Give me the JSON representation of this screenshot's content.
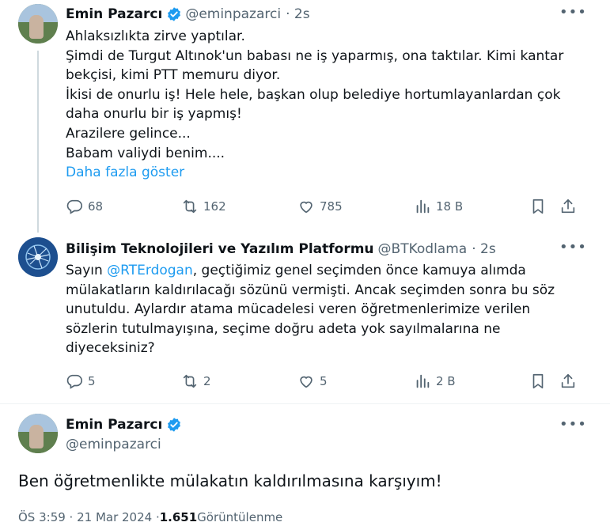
{
  "tweet1": {
    "author": "Emin Pazarcı",
    "handle": "@eminpazarci",
    "time": "· 2s",
    "lines": [
      "Ahlaksızlıkta zirve yaptılar.",
      "Şimdi de Turgut Altınok'un babası ne iş yaparmış, ona taktılar. Kimi kantar",
      "bekçisi, kimi PTT memuru diyor.",
      "İkisi de onurlu iş! Hele hele, başkan olup belediye hortumlayanlardan çok",
      "daha onurlu bir iş yapmış!",
      "Arazilere gelince...",
      "Babam valiydi benim...."
    ],
    "show_more": "Daha fazla göster",
    "replies": "68",
    "reposts": "162",
    "likes": "785",
    "views": "18 B"
  },
  "tweet2": {
    "author": "Bilişim Teknolojileri ve Yazılım Platformu",
    "handle": "@BTKodlama",
    "time": "· 2s",
    "line1_prefix": "Sayın ",
    "mention": "@RTErdogan",
    "line1_suffix": ", geçtiğimiz genel seçimden önce kamuya alımda",
    "lines": [
      "mülakatların kaldırılacağı sözünü vermişti. Ancak seçimden sonra bu söz",
      "unutuldu. Aylardır atama mücadelesi veren öğretmenlerimize verilen",
      "sözlerin tutulmayışına, seçime doğru adeta yok sayılmalarına ne",
      "diyeceksiniz?"
    ],
    "replies": "5",
    "reposts": "2",
    "likes": "5",
    "views": "2 B"
  },
  "tweet3": {
    "author": "Emin Pazarcı",
    "handle": "@eminpazarci",
    "text": "Ben öğretmenlikte mülakatın kaldırılmasına karşıyım!",
    "meta_time": "ÖS 3:59 · 21 Mar 2024 · ",
    "meta_views": "1.651",
    "meta_views_label": " Görüntülenme"
  },
  "colors": {
    "accent": "#1d9bf0",
    "muted": "#536471",
    "text": "#0f1419"
  },
  "icons": [
    "verified-badge-icon",
    "more-icon",
    "reply-icon",
    "repost-icon",
    "like-icon",
    "views-icon",
    "bookmark-icon",
    "share-icon"
  ]
}
